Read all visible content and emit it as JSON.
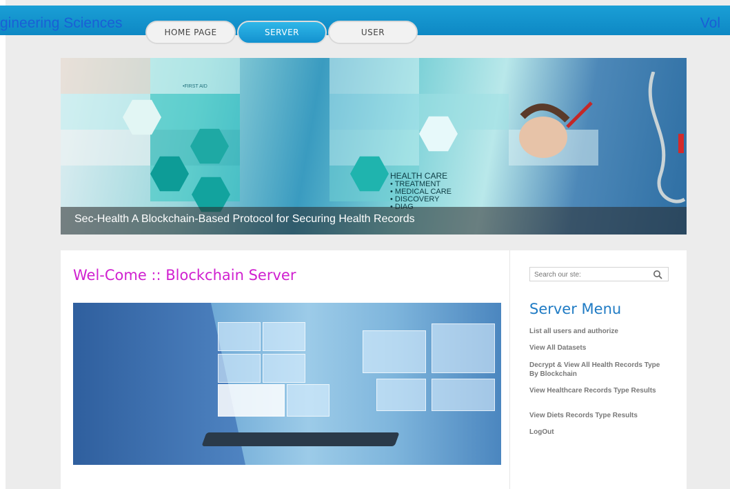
{
  "header": {
    "journal_left": "gineering Sciences",
    "journal_right": "Vol"
  },
  "nav": {
    "tabs": [
      {
        "label": "HOME PAGE",
        "active": false
      },
      {
        "label": "SERVER",
        "active": true
      },
      {
        "label": "USER",
        "active": false
      }
    ]
  },
  "banner": {
    "caption": "Sec-Health A Blockchain-Based Protocol for Securing Health Records",
    "art_text": {
      "first_aid": "•FIRST AID",
      "health_care": "HEALTH CARE",
      "items": [
        "• TREATMENT",
        "• MEDICAL CARE",
        "• DISCOVERY",
        "• DIAG"
      ]
    }
  },
  "main": {
    "welcome": "Wel-Come :: Blockchain Server"
  },
  "sidebar": {
    "search_placeholder": "Search our ste:",
    "menu_title": "Server Menu",
    "menu_items": [
      "List all users and authorize",
      "View All Datasets",
      "Decrypt & View All Health Records Type By Blockchain",
      "View Healthcare Records Type Results",
      "View Diets Records Type Results",
      "LogOut"
    ]
  },
  "colors": {
    "topbar": "#1a9fd6",
    "active_tab": "#1391cf",
    "welcome": "#d020d0",
    "menu_title": "#1f7bc4"
  }
}
